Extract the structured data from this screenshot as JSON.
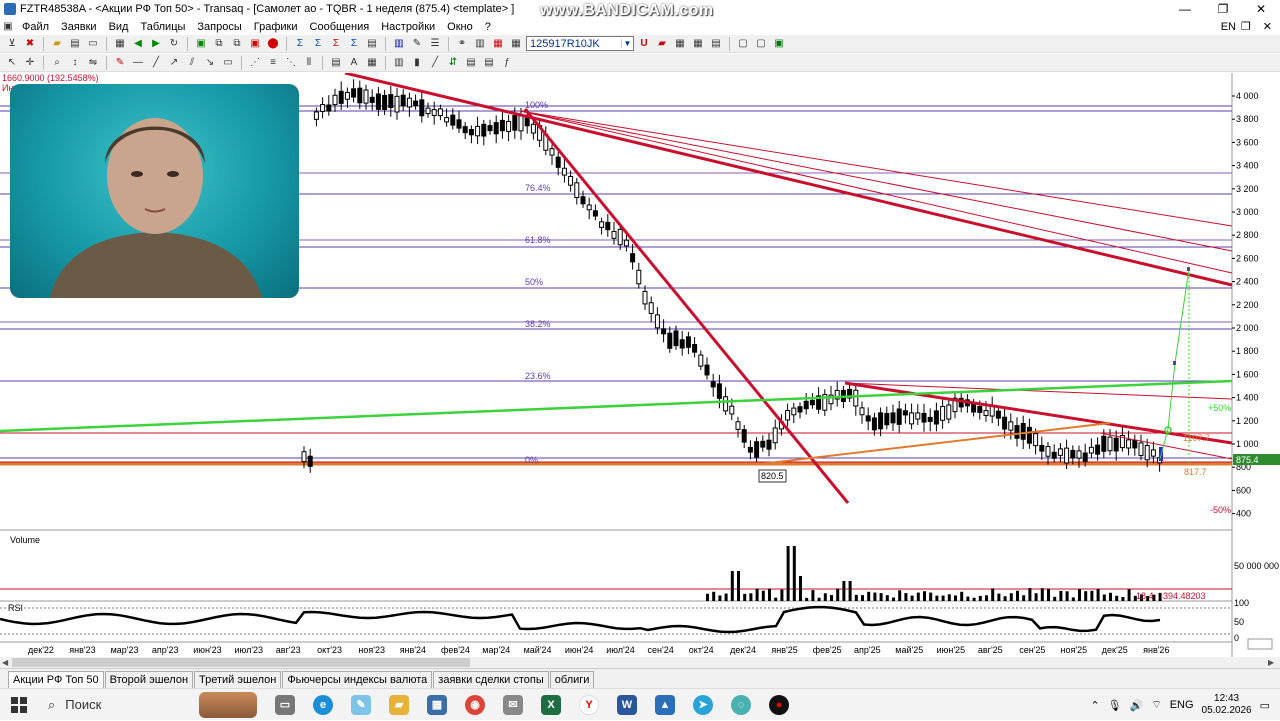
{
  "window": {
    "title": "FZTR48538A - <Акции РФ Топ 50> - Transaq - [Самолет ао - TQBR - 1 неделя (875.4) <template> ]",
    "watermark": "www.BANDICAM.com"
  },
  "menu": {
    "items": [
      "Файл",
      "Заявки",
      "Вид",
      "Таблицы",
      "Запросы",
      "Графики",
      "Сообщения",
      "Настройки",
      "Окно",
      "?"
    ],
    "lang": "EN"
  },
  "toolbar": {
    "account_combo": "125917R10JK"
  },
  "chart": {
    "header_value": "1660.9000 (192.5458%)",
    "indicator_label": "Инте",
    "price_labels": [
      "4 000",
      "3 800",
      "3 600",
      "3 400",
      "3 200",
      "3 000",
      "2 800",
      "2 600",
      "2 400",
      "2 200",
      "2 000",
      "1 800",
      "1 600",
      "1 400",
      "1 200",
      "1 000",
      "800",
      "600",
      "400"
    ],
    "current_price": "875.4",
    "fib_levels": [
      "100%",
      "76.4%",
      "61.8%",
      "50%",
      "38.2%",
      "23.6%",
      "0%"
    ],
    "annotations": {
      "low_label": "820.5",
      "plus50": "+50%",
      "minus50": "-50%",
      "level_1107": "1107.7",
      "level_817": "817.7"
    },
    "volume_title": "Volume",
    "volume_scale": "50 000 000",
    "volume_value": "18 4",
    "volume_value2": "394.48203",
    "rsi_title": "RSI",
    "rsi_scale": [
      "100",
      "50",
      "0"
    ],
    "x_labels": [
      "дек'22",
      "янв'23",
      "мар'23",
      "апр'23",
      "июн'23",
      "июл'23",
      "авг'23",
      "окт'23",
      "ноя'23",
      "янв'24",
      "фев'24",
      "мар'24",
      "май'24",
      "июн'24",
      "июл'24",
      "сен'24",
      "окт'24",
      "дек'24",
      "янв'25",
      "фев'25",
      "апр'25",
      "май'25",
      "июн'25",
      "авг'25",
      "сен'25",
      "ноя'25",
      "дек'25",
      "янв'26"
    ]
  },
  "tabs": [
    "Акции РФ Топ 50",
    "Второй эшелон",
    "Третий эшелон",
    "Фьючерсы индексы валюта",
    "заявки сделки стопы",
    "облиги"
  ],
  "taskbar": {
    "search_placeholder": "Поиск",
    "lang": "ENG",
    "time": "12:43",
    "date": "05.02.2026"
  },
  "colors": {
    "trendline_red": "#c8102e",
    "green_line": "#3cd23c",
    "orange_line": "#e07a2e",
    "fib_purple": "#5b3ca8",
    "price_tag": "#2e8b2e"
  }
}
